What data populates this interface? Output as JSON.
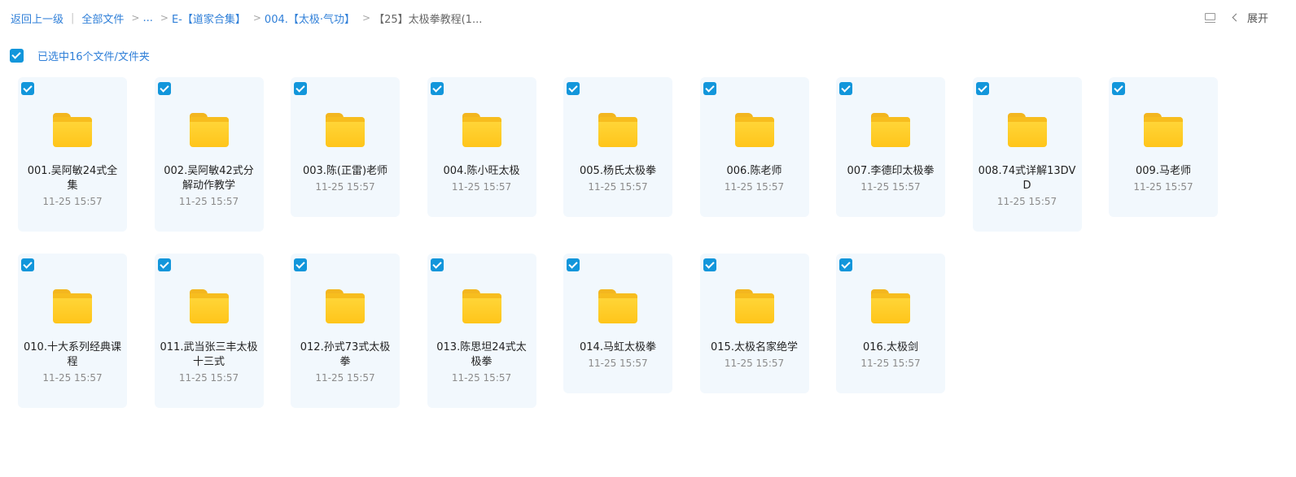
{
  "breadcrumb": {
    "back": "返回上一级",
    "all_files": "全部文件",
    "ellipsis": "...",
    "level1": "E-【道家合集】",
    "level2": "004.【太极·气功】",
    "current": "【25】太极拳教程(1..."
  },
  "toolbar": {
    "expand_label": "展开"
  },
  "selection": {
    "summary": "已选中16个文件/文件夹"
  },
  "items": [
    {
      "name": "001.吴阿敏24式全集",
      "date": "11-25 15:57"
    },
    {
      "name": "002.吴阿敏42式分解动作教学",
      "date": "11-25 15:57"
    },
    {
      "name": "003.陈(正雷)老师",
      "date": "11-25 15:57"
    },
    {
      "name": "004.陈小旺太极",
      "date": "11-25 15:57"
    },
    {
      "name": "005.杨氏太极拳",
      "date": "11-25 15:57"
    },
    {
      "name": "006.陈老师",
      "date": "11-25 15:57"
    },
    {
      "name": "007.李德印太极拳",
      "date": "11-25 15:57"
    },
    {
      "name": "008.74式详解13DVD",
      "date": "11-25 15:57"
    },
    {
      "name": "009.马老师",
      "date": "11-25 15:57"
    },
    {
      "name": "010.十大系列经典课程",
      "date": "11-25 15:57"
    },
    {
      "name": "011.武当张三丰太极十三式",
      "date": "11-25 15:57"
    },
    {
      "name": "012.孙式73式太极拳",
      "date": "11-25 15:57"
    },
    {
      "name": "013.陈思坦24式太极拳",
      "date": "11-25 15:57"
    },
    {
      "name": "014.马虹太极拳",
      "date": "11-25 15:57"
    },
    {
      "name": "015.太极名家绝学",
      "date": "11-25 15:57"
    },
    {
      "name": "016.太极剑",
      "date": "11-25 15:57"
    }
  ]
}
